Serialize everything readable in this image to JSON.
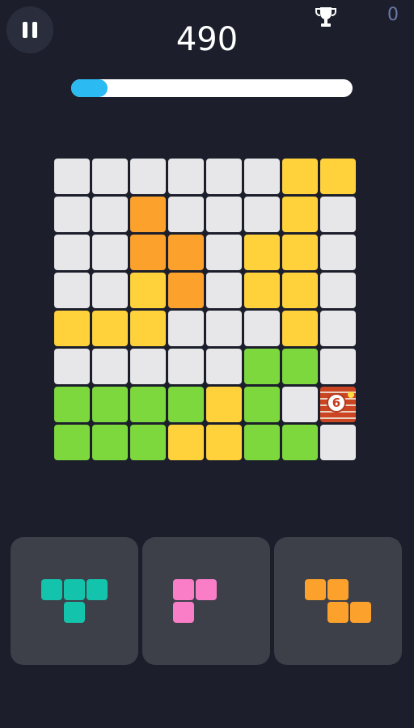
{
  "header": {
    "score": "490",
    "best_score": "0",
    "progress_fraction": 0.13
  },
  "icons": {
    "pause": "pause-icon",
    "trophy": "trophy-icon",
    "bomb": "bomb-icon"
  },
  "colors": {
    "background": "#1c1f2b",
    "empty": "#e7e7e9",
    "yellow": "#ffd23c",
    "orange": "#fca22c",
    "green": "#7dd83d",
    "teal": "#14c3ab",
    "pink": "#f97dc7",
    "piece_orange": "#fca22c",
    "progress": "#2bbaf2"
  },
  "board": {
    "rows": [
      [
        "empty",
        "empty",
        "empty",
        "empty",
        "empty",
        "empty",
        "yellow",
        "yellow"
      ],
      [
        "empty",
        "empty",
        "orange",
        "empty",
        "empty",
        "empty",
        "yellow",
        "empty"
      ],
      [
        "empty",
        "empty",
        "orange",
        "orange",
        "empty",
        "yellow",
        "yellow",
        "empty"
      ],
      [
        "empty",
        "empty",
        "yellow",
        "orange",
        "empty",
        "yellow",
        "yellow",
        "empty"
      ],
      [
        "yellow",
        "yellow",
        "yellow",
        "empty",
        "empty",
        "empty",
        "yellow",
        "empty"
      ],
      [
        "empty",
        "empty",
        "empty",
        "empty",
        "empty",
        "green",
        "green",
        "empty"
      ],
      [
        "green",
        "green",
        "green",
        "green",
        "yellow",
        "green",
        "empty",
        "bomb"
      ],
      [
        "green",
        "green",
        "green",
        "yellow",
        "yellow",
        "green",
        "green",
        "empty"
      ]
    ],
    "bomb": {
      "row": 6,
      "col": 7,
      "counter": "6"
    }
  },
  "pieces": [
    {
      "name": "teal-t-piece",
      "color": "teal",
      "shape": [
        [
          1,
          1,
          1
        ],
        [
          0,
          1,
          0
        ]
      ]
    },
    {
      "name": "pink-l-piece",
      "color": "pink",
      "shape": [
        [
          1,
          1,
          0
        ],
        [
          1,
          0,
          0
        ]
      ]
    },
    {
      "name": "orange-z-piece",
      "color": "piece_orange",
      "shape": [
        [
          1,
          1,
          0
        ],
        [
          0,
          1,
          1
        ]
      ]
    }
  ]
}
